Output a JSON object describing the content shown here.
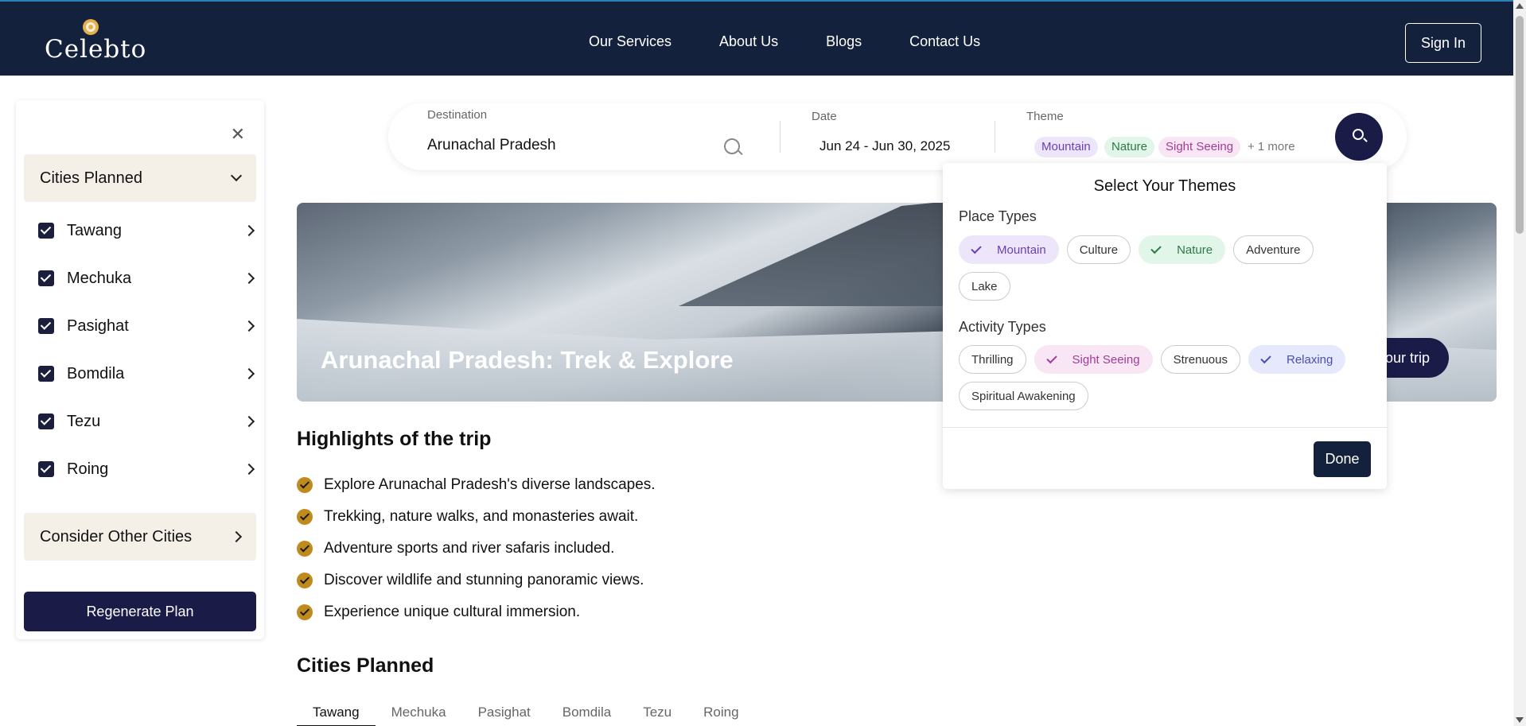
{
  "header": {
    "logo_text": "Celebto",
    "nav": [
      "Our Services",
      "About Us",
      "Blogs",
      "Contact Us"
    ],
    "signin_label": "Sign In"
  },
  "sidebar": {
    "cities_planned_label": "Cities Planned",
    "cities": [
      "Tawang",
      "Mechuka",
      "Pasighat",
      "Bomdila",
      "Tezu",
      "Roing"
    ],
    "consider_label": "Consider Other Cities",
    "regenerate_label": "Regenerate Plan"
  },
  "search": {
    "destination_label": "Destination",
    "destination_value": "Arunachal Pradesh",
    "date_label": "Date",
    "date_value": "Jun 24 - Jun 30, 2025",
    "theme_label": "Theme",
    "theme_chips": [
      {
        "label": "Mountain",
        "bg": "#ede6fb",
        "fg": "#6b3fb5"
      },
      {
        "label": "Nature",
        "bg": "#e1f5e8",
        "fg": "#2c7a46"
      },
      {
        "label": "Sight Seeing",
        "bg": "#f8e6f5",
        "fg": "#a23c97"
      }
    ],
    "more_label": "+ 1 more"
  },
  "hero": {
    "title": "Arunachal Pradesh: Trek & Explore",
    "button_label": "our trip"
  },
  "highlights": {
    "title": "Highlights of the trip",
    "items": [
      "Explore Arunachal Pradesh's diverse landscapes.",
      "Trekking, nature walks, and monasteries await.",
      "Adventure sports and river safaris included.",
      "Discover wildlife and stunning panoramic views.",
      "Experience unique cultural immersion."
    ]
  },
  "cities_section": {
    "title": "Cities Planned",
    "tabs": [
      "Tawang",
      "Mechuka",
      "Pasighat",
      "Bomdila",
      "Tezu",
      "Roing"
    ]
  },
  "theme_popover": {
    "title": "Select Your Themes",
    "place_label": "Place Types",
    "place_types": [
      {
        "label": "Mountain",
        "selected": true,
        "bg": "#ede6fb",
        "fg": "#6b3fb5"
      },
      {
        "label": "Culture",
        "selected": false
      },
      {
        "label": "Nature",
        "selected": true,
        "bg": "#e1f5e8",
        "fg": "#2c7a46"
      },
      {
        "label": "Adventure",
        "selected": false
      },
      {
        "label": "Lake",
        "selected": false
      }
    ],
    "activity_label": "Activity Types",
    "activity_types": [
      {
        "label": "Thrilling",
        "selected": false
      },
      {
        "label": "Sight Seeing",
        "selected": true,
        "bg": "#f8e6f5",
        "fg": "#a23c97"
      },
      {
        "label": "Strenuous",
        "selected": false
      },
      {
        "label": "Relaxing",
        "selected": true,
        "bg": "#e6e8fb",
        "fg": "#4a4fb0"
      },
      {
        "label": "Spiritual Awakening",
        "selected": false
      }
    ],
    "done_label": "Done"
  }
}
